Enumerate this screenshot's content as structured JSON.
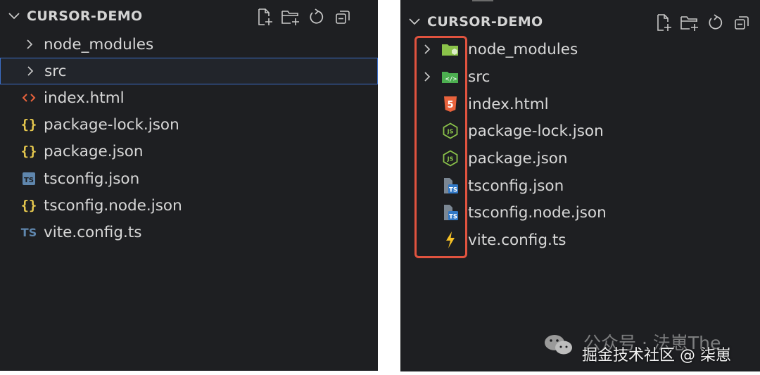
{
  "theme": {
    "panel_bg": "#1e1f22",
    "text": "#d8d8d8",
    "selection_border": "#3b6ec8",
    "highlight_box": "#e0533f",
    "json_brace": "#e6c84e",
    "ts": "#5f86ad",
    "html_orange": "#e8623c",
    "folder_green": "#8bc34a",
    "vite_yellow": "#f6c125"
  },
  "left_explorer": {
    "title": "CURSOR-DEMO",
    "actions": [
      "new-file-icon",
      "new-folder-icon",
      "refresh-icon",
      "collapse-all-icon"
    ],
    "items": [
      {
        "name": "node_modules",
        "kind": "folder",
        "icon": "chevron-right-icon",
        "selected": false
      },
      {
        "name": "src",
        "kind": "folder",
        "icon": "chevron-right-icon",
        "selected": true
      },
      {
        "name": "index.html",
        "kind": "file",
        "icon": "html-angle-brackets-icon",
        "icon_text": "<>"
      },
      {
        "name": "package-lock.json",
        "kind": "file",
        "icon": "json-braces-icon",
        "icon_text": "{}"
      },
      {
        "name": "package.json",
        "kind": "file",
        "icon": "json-braces-icon",
        "icon_text": "{}"
      },
      {
        "name": "tsconfig.json",
        "kind": "file",
        "icon": "tsconfig-icon",
        "icon_text": "TS"
      },
      {
        "name": "tsconfig.node.json",
        "kind": "file",
        "icon": "json-braces-icon",
        "icon_text": "{}"
      },
      {
        "name": "vite.config.ts",
        "kind": "file",
        "icon": "typescript-icon",
        "icon_text": "TS"
      }
    ]
  },
  "right_explorer": {
    "title": "CURSOR-DEMO",
    "actions": [
      "new-file-icon",
      "new-folder-icon",
      "refresh-icon",
      "collapse-all-icon"
    ],
    "items": [
      {
        "name": "node_modules",
        "kind": "folder",
        "icon": "node-folder-icon"
      },
      {
        "name": "src",
        "kind": "folder",
        "icon": "src-folder-icon",
        "icon_text": "</>"
      },
      {
        "name": "index.html",
        "kind": "file",
        "icon": "html5-icon",
        "icon_text": "5"
      },
      {
        "name": "package-lock.json",
        "kind": "file",
        "icon": "nodejs-icon",
        "icon_text": "JS"
      },
      {
        "name": "package.json",
        "kind": "file",
        "icon": "nodejs-icon",
        "icon_text": "JS"
      },
      {
        "name": "tsconfig.json",
        "kind": "file",
        "icon": "tsconfig-file-icon",
        "icon_text": "TS"
      },
      {
        "name": "tsconfig.node.json",
        "kind": "file",
        "icon": "tsconfig-file-icon",
        "icon_text": "TS"
      },
      {
        "name": "vite.config.ts",
        "kind": "file",
        "icon": "vite-bolt-icon"
      }
    ]
  },
  "watermark": {
    "line1": "公众号 · 法崽The",
    "line2": "掘金技术社区 @ 柒崽"
  }
}
